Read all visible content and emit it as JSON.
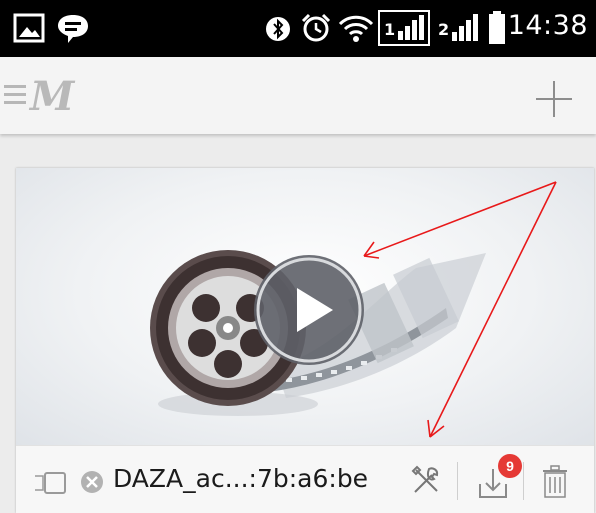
{
  "status_bar": {
    "time": "14:38",
    "icons": [
      "gallery-icon",
      "chat-icon",
      "bluetooth-icon",
      "alarm-icon",
      "wifi-icon",
      "signal-1-icon",
      "signal-2-icon",
      "battery-icon"
    ],
    "sim1_label": "1",
    "sim2_label": "2"
  },
  "toolbar": {
    "logo_text": "M",
    "icons": [
      "menu-icon",
      "add-icon"
    ]
  },
  "card": {
    "file_name": "DAZA_ac...:7b:a6:be",
    "notification_count": "9",
    "icons": [
      "cast-icon",
      "cancel-icon",
      "tools-icon",
      "download-icon",
      "trash-icon",
      "play-icon",
      "film-reel-icon"
    ]
  },
  "annotation": {
    "arrow_color": "#e8191a"
  }
}
